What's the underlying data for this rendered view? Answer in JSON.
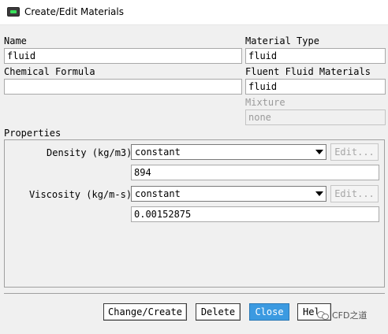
{
  "window": {
    "title": "Create/Edit Materials",
    "icon": "fluent-app-icon"
  },
  "left": {
    "name_label": "Name",
    "name_value": "fluid",
    "formula_label": "Chemical Formula",
    "formula_value": ""
  },
  "right": {
    "material_type_label": "Material Type",
    "material_type_value": "fluid",
    "fluent_fluid_label": "Fluent Fluid Materials",
    "fluent_fluid_value": "fluid",
    "mixture_label": "Mixture",
    "mixture_value": "none"
  },
  "properties": {
    "title": "Properties",
    "density": {
      "label": "Density (kg/m3)",
      "method": "constant",
      "edit": "Edit...",
      "value": "894"
    },
    "viscosity": {
      "label": "Viscosity (kg/m-s)",
      "method": "constant",
      "edit": "Edit...",
      "value": "0.00152875"
    }
  },
  "buttons": {
    "change_create": "Change/Create",
    "delete": "Delete",
    "close": "Close",
    "help": "Hel"
  },
  "watermark": {
    "text": "CFD之道",
    "icon": "wechat-icon"
  },
  "colors": {
    "close_button": "#3b9ae1",
    "title_icon_accent": "#38e05a"
  }
}
